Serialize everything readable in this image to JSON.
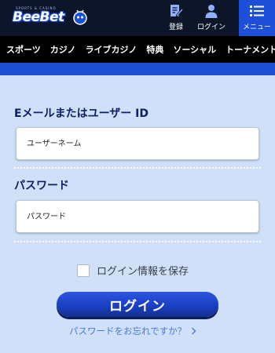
{
  "header": {
    "logo_text": "BeeBet",
    "logo_sub": "SPORTS & CASINO",
    "register_label": "登録",
    "login_label": "ログイン",
    "menu_label": "メニュー"
  },
  "nav": {
    "items": [
      "スポーツ",
      "カジノ",
      "ライブカジノ",
      "特典",
      "ソーシャル",
      "トーナメント"
    ]
  },
  "form": {
    "email_label": "Eメールまたはユーザー ID",
    "username_placeholder": "ユーザーネーム",
    "password_label": "パスワード",
    "password_placeholder": "パスワード",
    "remember_label": "ログイン情報を保存",
    "login_button": "ログイン",
    "forgot_link": "パスワードをお忘れですか？"
  },
  "colors": {
    "topbar": "#0d1628",
    "accent": "#1f4fd6",
    "background": "#cfe0f8",
    "label": "#0d2266",
    "link": "#4a78d6"
  }
}
